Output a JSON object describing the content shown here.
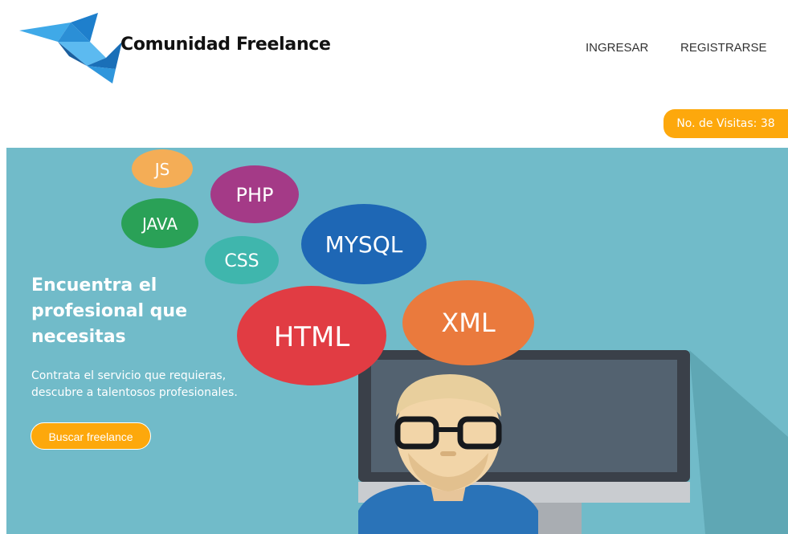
{
  "header": {
    "brand_name": "Comunidad Freelance",
    "nav": {
      "login": "INGRESAR",
      "register": "REGISTRARSE"
    }
  },
  "visits": {
    "label": "No. de Visitas: 38"
  },
  "hero": {
    "title": "Encuentra el profesional que necesitas",
    "description": "Contrata el servicio que requieras, descubre a talentosos profesionales.",
    "cta_label": "Buscar freelance",
    "bubbles": {
      "js": "JS",
      "php": "PHP",
      "java": "JAVA",
      "css": "CSS",
      "mysql": "MYSQL",
      "html": "HTML",
      "xml": "XML"
    }
  },
  "colors": {
    "accent": "#fda80c",
    "hero_background": "#71bbc9",
    "logo_blue": "#2b8fd6"
  },
  "icons": {
    "logo": "origami-bird-logo",
    "hero_illustration": "developer-at-monitor-illustration"
  }
}
